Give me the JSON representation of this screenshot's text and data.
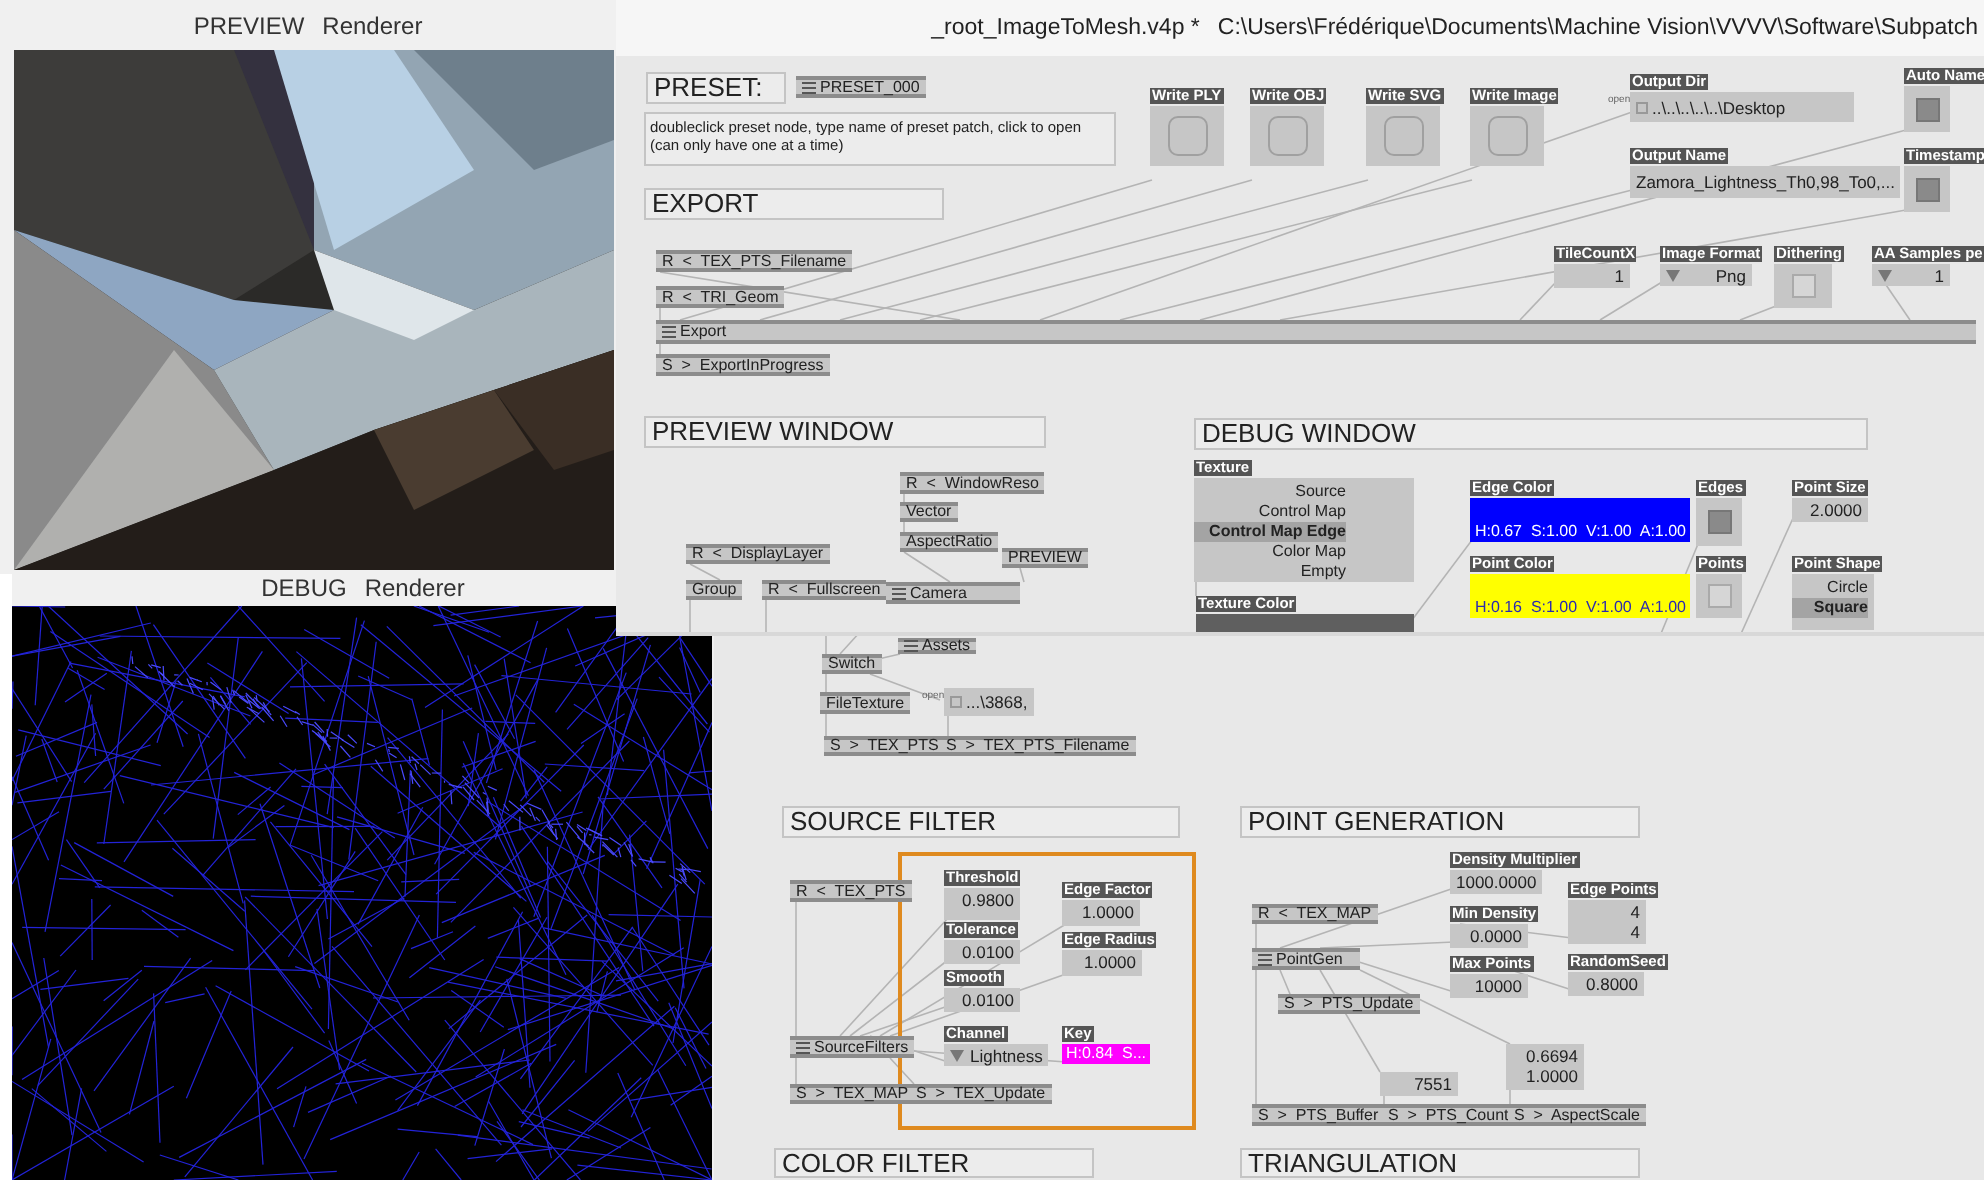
{
  "preview_window": {
    "title": "PREVIEW",
    "subtitle": "Renderer"
  },
  "debug_window": {
    "title": "DEBUG",
    "subtitle": "Renderer"
  },
  "patch_window": {
    "title": "_root_ImageToMesh.v4p *",
    "path": "C:\\Users\\Frédérique\\Documents\\Machine Vision\\VVVV\\Software\\Subpatch"
  },
  "patch_items": [
    {
      "kind": "comment",
      "text": "PRESET:"
    },
    {
      "kind": "subpatch",
      "text": "PRESET_000"
    },
    {
      "kind": "note",
      "text": "doubleclick preset node, type name of preset patch, click to open\n(can only have one at a time)"
    },
    {
      "kind": "comment",
      "text": "EXPORT"
    },
    {
      "kind": "bang",
      "label": "Write PLY"
    },
    {
      "kind": "bang",
      "label": "Write OBJ"
    },
    {
      "kind": "bang",
      "label": "Write SVG"
    },
    {
      "kind": "bang",
      "label": "Write Image"
    },
    {
      "kind": "string",
      "label": "Output Dir",
      "open_label": "open",
      "value": "..\\..\\..\\..\\..\\Desktop"
    },
    {
      "kind": "string",
      "label": "Output Name",
      "value": "Zamora_Lightness_Th0,98_To0,..."
    },
    {
      "kind": "toggle",
      "label": "Auto Name",
      "on": true
    },
    {
      "kind": "toggle",
      "label": "Timestamp",
      "on": true
    },
    {
      "kind": "node",
      "text": "R  <  TEX_PTS_Filename"
    },
    {
      "kind": "node",
      "text": "R  <  TRI_Geom"
    },
    {
      "kind": "subpatch",
      "text": "Export"
    },
    {
      "kind": "node",
      "text": "S  >  ExportInProgress"
    },
    {
      "kind": "value",
      "label": "TileCountX",
      "values": [
        "1"
      ]
    },
    {
      "kind": "enum",
      "label": "Image Format",
      "value": "Png"
    },
    {
      "kind": "toggle",
      "label": "Dithering",
      "on": false
    },
    {
      "kind": "enum",
      "label": "AA Samples pe",
      "value": "1"
    },
    {
      "kind": "comment",
      "text": "PREVIEW WINDOW"
    },
    {
      "kind": "comment",
      "text": "DEBUG WINDOW"
    },
    {
      "kind": "node",
      "text": "R  <  WindowReso"
    },
    {
      "kind": "node",
      "text": "Vector"
    },
    {
      "kind": "node",
      "text": "AspectRatio"
    },
    {
      "kind": "node",
      "text": "R  <  DisplayLayer"
    },
    {
      "kind": "node",
      "text": "PREVIEW"
    },
    {
      "kind": "node",
      "text": "Group"
    },
    {
      "kind": "node",
      "text": "R  <  Fullscreen"
    },
    {
      "kind": "subpatch",
      "text": "Camera"
    },
    {
      "kind": "list",
      "label": "Texture",
      "options": [
        {
          "text": "Source",
          "selected": false
        },
        {
          "text": "Control Map",
          "selected": false
        },
        {
          "text": "Control Map Edge",
          "selected": true
        },
        {
          "text": "Color Map",
          "selected": false
        },
        {
          "text": "Empty",
          "selected": false
        }
      ]
    },
    {
      "kind": "color",
      "label": "Texture Color",
      "color": "#5f5f5f"
    },
    {
      "kind": "color",
      "label": "Edge Color",
      "color": "#0000ff",
      "value": "H:0.67  S:1.00  V:1.00  A:1.00"
    },
    {
      "kind": "toggle",
      "label": "Edges",
      "on": true
    },
    {
      "kind": "color",
      "label": "Point Color",
      "color": "#ffff00",
      "value": "H:0.16  S:1.00  V:1.00  A:1.00"
    },
    {
      "kind": "toggle",
      "label": "Points",
      "on": false
    },
    {
      "kind": "value",
      "label": "Point Size",
      "values": [
        "2.0000"
      ]
    },
    {
      "kind": "list",
      "label": "Point Shape",
      "options": [
        {
          "text": "Circle",
          "selected": false
        },
        {
          "text": "Square",
          "selected": true
        }
      ]
    }
  ],
  "background_items": [
    {
      "kind": "subpatch",
      "text": "Assets"
    },
    {
      "kind": "node",
      "text": "Switch"
    },
    {
      "kind": "node",
      "text": "FileTexture"
    },
    {
      "kind": "string",
      "open_label": "open",
      "value": "...\\3868,"
    },
    {
      "kind": "node",
      "text": "S  >  TEX_PTS"
    },
    {
      "kind": "node",
      "text": "S  >  TEX_PTS_Filename"
    },
    {
      "kind": "comment",
      "text": "SOURCE FILTER"
    },
    {
      "kind": "node",
      "text": "R  <  TEX_PTS"
    },
    {
      "kind": "value",
      "label": "Threshold",
      "values": [
        "0.9800"
      ]
    },
    {
      "kind": "value",
      "label": "Tolerance",
      "values": [
        "0.0100"
      ]
    },
    {
      "kind": "value",
      "label": "Smooth",
      "values": [
        "0.0100"
      ]
    },
    {
      "kind": "subpatch",
      "text": "SourceFilters"
    },
    {
      "kind": "enum",
      "label": "Channel",
      "value": "Lightness"
    },
    {
      "kind": "value",
      "label": "Edge Factor",
      "values": [
        "1.0000"
      ]
    },
    {
      "kind": "value",
      "label": "Edge Radius",
      "values": [
        "1.0000"
      ]
    },
    {
      "kind": "color",
      "label": "Key",
      "color": "#ff00ff",
      "value": "H:0.84  S..."
    },
    {
      "kind": "node",
      "text": "S  >  TEX_MAP"
    },
    {
      "kind": "node",
      "text": "S  >  TEX_Update"
    },
    {
      "kind": "comment",
      "text": "COLOR FILTER"
    },
    {
      "kind": "comment",
      "text": "POINT GENERATION"
    },
    {
      "kind": "node",
      "text": "R  <  TEX_MAP"
    },
    {
      "kind": "subpatch",
      "text": "PointGen"
    },
    {
      "kind": "node",
      "text": "S  >  PTS_Update"
    },
    {
      "kind": "value",
      "label": "Density Multiplier",
      "values": [
        "1000.0000"
      ]
    },
    {
      "kind": "value",
      "label": "Min Density",
      "values": [
        "0.0000"
      ]
    },
    {
      "kind": "value",
      "label": "Max Points",
      "values": [
        "10000"
      ]
    },
    {
      "kind": "value",
      "label": "Edge Points",
      "values": [
        "4",
        "4"
      ]
    },
    {
      "kind": "value",
      "label": "RandomSeed",
      "values": [
        "0.8000"
      ]
    },
    {
      "kind": "value",
      "values": [
        "7551"
      ]
    },
    {
      "kind": "value",
      "values": [
        "0.6694",
        "1.0000"
      ]
    },
    {
      "kind": "node",
      "text": "S  >  PTS_Buffer"
    },
    {
      "kind": "node",
      "text": "S  >  PTS_Count"
    },
    {
      "kind": "node",
      "text": "S  >  AspectScale"
    },
    {
      "kind": "comment",
      "text": "TRIANGULATION"
    }
  ]
}
